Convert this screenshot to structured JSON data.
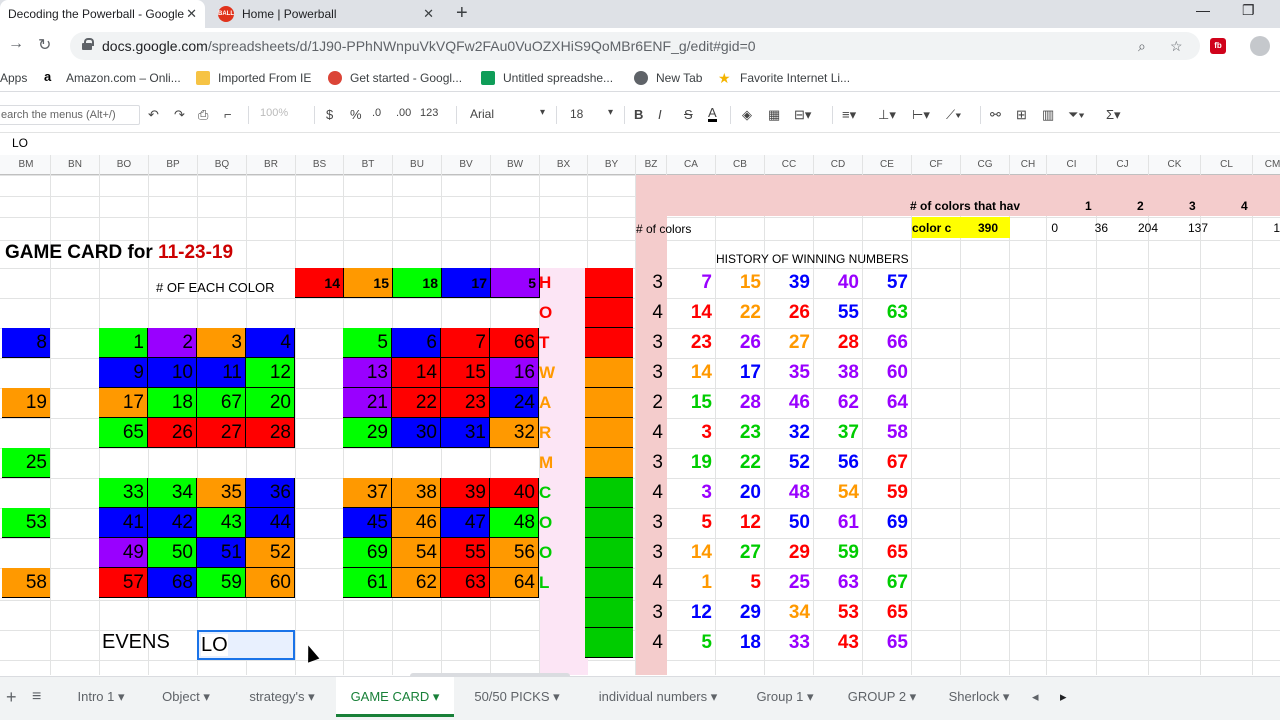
{
  "browser": {
    "tabs": [
      {
        "title": "Decoding the Powerball - Google",
        "active": true
      },
      {
        "title": "Home | Powerball",
        "active": false,
        "favicon_text": "BALL"
      }
    ],
    "new_tab_label": "+",
    "url_host": "docs.google.com",
    "url_path": "/spreadsheets/d/1J90-PPhNWnpuVkVQFw2FAu0VuOZXHiS9QoMBr6ENF_g/edit#gid=0",
    "bookmarks": [
      {
        "label": "Apps",
        "icon": "apps-grid-icon"
      },
      {
        "label": "Amazon.com – Onli...",
        "icon": "amazon-icon"
      },
      {
        "label": "Imported From IE",
        "icon": "folder-icon"
      },
      {
        "label": "Get started - Googl...",
        "icon": "chrome-icon"
      },
      {
        "label": "Untitled spreadshe...",
        "icon": "sheets-icon"
      },
      {
        "label": "New Tab",
        "icon": "globe-icon"
      },
      {
        "label": "Favorite Internet Li...",
        "icon": "star-icon"
      }
    ]
  },
  "toolbar": {
    "search_placeholder": "earch the menus (Alt+/)",
    "zoom": "100%",
    "currency": "$",
    "percent": "%",
    "dec_less": ".0",
    "dec_more": ".00",
    "format": "123",
    "font": "Arial",
    "font_size": "18",
    "bold": "B",
    "italic": "I",
    "strike": "S",
    "text_color": "A"
  },
  "formula_bar": {
    "value": "LO"
  },
  "columns": [
    "BM",
    "BN",
    "BO",
    "BP",
    "BQ",
    "BR",
    "BS",
    "BT",
    "BU",
    "BV",
    "BW",
    "BX",
    "BY",
    "BZ",
    "CA",
    "CB",
    "CC",
    "CD",
    "CE",
    "CF",
    "CG",
    "CH",
    "CI",
    "CJ",
    "CK",
    "CL",
    "CM"
  ],
  "sheet": {
    "title_prefix": "GAME CARD for ",
    "title_date": "11-23-19",
    "each_color_label": "# OF EACH COLOR",
    "color_counts": [
      {
        "value": "14",
        "color": "#ff0000"
      },
      {
        "value": "15",
        "color": "#ff9900"
      },
      {
        "value": "18",
        "color": "#00ff00"
      },
      {
        "value": "17",
        "color": "#0000ff"
      },
      {
        "value": "5",
        "color": "#9900ff"
      }
    ],
    "num_colors_label": "# of colors",
    "colors_that_have_label": "# of colors that hav",
    "colors_that_have_values": [
      "1",
      "2",
      "3",
      "4"
    ],
    "color_c_label": "color c",
    "color_c_value": "390",
    "color_c_row": [
      "0",
      "36",
      "204",
      "137",
      "1"
    ],
    "history_label": "HISTORY OF WINNING NUMBERS",
    "evens_label": "EVENS",
    "active_cell_value": "LO",
    "left_numbers": [
      {
        "value": "8",
        "color": "#0000ff"
      },
      {
        "value": "19",
        "color": "#ff9900"
      },
      {
        "value": "25",
        "color": "#00ff00"
      },
      {
        "value": "53",
        "color": "#00ff00"
      },
      {
        "value": "58",
        "color": "#ff9900"
      }
    ],
    "card_left": [
      [
        {
          "v": "1",
          "c": "#00ff00"
        },
        {
          "v": "2",
          "c": "#9900ff"
        },
        {
          "v": "3",
          "c": "#ff9900"
        },
        {
          "v": "4",
          "c": "#0000ff"
        }
      ],
      [
        {
          "v": "9",
          "c": "#0000ff"
        },
        {
          "v": "10",
          "c": "#0000ff"
        },
        {
          "v": "11",
          "c": "#0000ff"
        },
        {
          "v": "12",
          "c": "#00ff00"
        }
      ],
      [
        {
          "v": "17",
          "c": "#ff9900"
        },
        {
          "v": "18",
          "c": "#00ff00"
        },
        {
          "v": "67",
          "c": "#00ff00"
        },
        {
          "v": "20",
          "c": "#00ff00"
        }
      ],
      [
        {
          "v": "65",
          "c": "#00ff00"
        },
        {
          "v": "26",
          "c": "#ff0000"
        },
        {
          "v": "27",
          "c": "#ff0000"
        },
        {
          "v": "28",
          "c": "#ff0000"
        }
      ],
      [],
      [
        {
          "v": "33",
          "c": "#00ff00"
        },
        {
          "v": "34",
          "c": "#00ff00"
        },
        {
          "v": "35",
          "c": "#ff9900"
        },
        {
          "v": "36",
          "c": "#0000ff"
        }
      ],
      [
        {
          "v": "41",
          "c": "#0000ff"
        },
        {
          "v": "42",
          "c": "#0000ff"
        },
        {
          "v": "43",
          "c": "#00ff00"
        },
        {
          "v": "44",
          "c": "#0000ff"
        }
      ],
      [
        {
          "v": "49",
          "c": "#9900ff"
        },
        {
          "v": "50",
          "c": "#00ff00"
        },
        {
          "v": "51",
          "c": "#0000ff"
        },
        {
          "v": "52",
          "c": "#ff9900"
        }
      ],
      [
        {
          "v": "57",
          "c": "#ff0000"
        },
        {
          "v": "68",
          "c": "#0000ff"
        },
        {
          "v": "59",
          "c": "#00ff00"
        },
        {
          "v": "60",
          "c": "#ff9900"
        }
      ]
    ],
    "card_right": [
      [
        {
          "v": "5",
          "c": "#00ff00"
        },
        {
          "v": "6",
          "c": "#0000ff"
        },
        {
          "v": "7",
          "c": "#ff0000"
        },
        {
          "v": "66",
          "c": "#ff0000"
        }
      ],
      [
        {
          "v": "13",
          "c": "#9900ff"
        },
        {
          "v": "14",
          "c": "#ff0000"
        },
        {
          "v": "15",
          "c": "#ff0000"
        },
        {
          "v": "16",
          "c": "#9900ff"
        }
      ],
      [
        {
          "v": "21",
          "c": "#9900ff"
        },
        {
          "v": "22",
          "c": "#ff0000"
        },
        {
          "v": "23",
          "c": "#ff0000"
        },
        {
          "v": "24",
          "c": "#0000ff"
        }
      ],
      [
        {
          "v": "29",
          "c": "#00ff00"
        },
        {
          "v": "30",
          "c": "#0000ff"
        },
        {
          "v": "31",
          "c": "#0000ff"
        },
        {
          "v": "32",
          "c": "#ff9900"
        }
      ],
      [],
      [
        {
          "v": "37",
          "c": "#ff9900"
        },
        {
          "v": "38",
          "c": "#ff9900"
        },
        {
          "v": "39",
          "c": "#ff0000"
        },
        {
          "v": "40",
          "c": "#ff0000"
        }
      ],
      [
        {
          "v": "45",
          "c": "#0000ff"
        },
        {
          "v": "46",
          "c": "#ff9900"
        },
        {
          "v": "47",
          "c": "#0000ff"
        },
        {
          "v": "48",
          "c": "#00ff00"
        }
      ],
      [
        {
          "v": "69",
          "c": "#00ff00"
        },
        {
          "v": "54",
          "c": "#ff9900"
        },
        {
          "v": "55",
          "c": "#ff0000"
        },
        {
          "v": "56",
          "c": "#ff9900"
        }
      ],
      [
        {
          "v": "61",
          "c": "#00ff00"
        },
        {
          "v": "62",
          "c": "#ff9900"
        },
        {
          "v": "63",
          "c": "#ff0000"
        },
        {
          "v": "64",
          "c": "#ff9900"
        }
      ]
    ],
    "hot_cold_letters": [
      {
        "l": "H",
        "c": "#ff0000"
      },
      {
        "l": "O",
        "c": "#ff0000"
      },
      {
        "l": "T",
        "c": "#ff0000"
      },
      {
        "l": "W",
        "c": "#ff9900"
      },
      {
        "l": "A",
        "c": "#ff9900"
      },
      {
        "l": "R",
        "c": "#ff9900"
      },
      {
        "l": "M",
        "c": "#ff9900"
      },
      {
        "l": "C",
        "c": "#00cc00"
      },
      {
        "l": "O",
        "c": "#00cc00"
      },
      {
        "l": "O",
        "c": "#00cc00"
      },
      {
        "l": "L",
        "c": "#00cc00"
      }
    ],
    "side_colors": [
      "#ff0000",
      "#ff0000",
      "#ff0000",
      "#ff9900",
      "#ff9900",
      "#ff9900",
      "#ff9900",
      "#00cc00",
      "#00cc00",
      "#00cc00",
      "#00cc00",
      "#00cc00",
      "#00cc00"
    ],
    "history": [
      {
        "count": "3",
        "nums": [
          {
            "v": "7",
            "c": "#9900ff"
          },
          {
            "v": "15",
            "c": "#ff9900"
          },
          {
            "v": "39",
            "c": "#0000ff"
          },
          {
            "v": "40",
            "c": "#9900ff"
          },
          {
            "v": "57",
            "c": "#0000ff"
          }
        ]
      },
      {
        "count": "4",
        "nums": [
          {
            "v": "14",
            "c": "#ff0000"
          },
          {
            "v": "22",
            "c": "#ff9900"
          },
          {
            "v": "26",
            "c": "#ff0000"
          },
          {
            "v": "55",
            "c": "#0000ff"
          },
          {
            "v": "63",
            "c": "#00cc00"
          }
        ]
      },
      {
        "count": "3",
        "nums": [
          {
            "v": "23",
            "c": "#ff0000"
          },
          {
            "v": "26",
            "c": "#9900ff"
          },
          {
            "v": "27",
            "c": "#ff9900"
          },
          {
            "v": "28",
            "c": "#ff0000"
          },
          {
            "v": "66",
            "c": "#9900ff"
          }
        ]
      },
      {
        "count": "3",
        "nums": [
          {
            "v": "14",
            "c": "#ff9900"
          },
          {
            "v": "17",
            "c": "#0000ff"
          },
          {
            "v": "35",
            "c": "#9900ff"
          },
          {
            "v": "38",
            "c": "#9900ff"
          },
          {
            "v": "60",
            "c": "#9900ff"
          }
        ]
      },
      {
        "count": "2",
        "nums": [
          {
            "v": "15",
            "c": "#00cc00"
          },
          {
            "v": "28",
            "c": "#9900ff"
          },
          {
            "v": "46",
            "c": "#9900ff"
          },
          {
            "v": "62",
            "c": "#9900ff"
          },
          {
            "v": "64",
            "c": "#9900ff"
          }
        ]
      },
      {
        "count": "4",
        "nums": [
          {
            "v": "3",
            "c": "#ff0000"
          },
          {
            "v": "23",
            "c": "#00cc00"
          },
          {
            "v": "32",
            "c": "#0000ff"
          },
          {
            "v": "37",
            "c": "#00cc00"
          },
          {
            "v": "58",
            "c": "#9900ff"
          }
        ]
      },
      {
        "count": "3",
        "nums": [
          {
            "v": "19",
            "c": "#00cc00"
          },
          {
            "v": "22",
            "c": "#00cc00"
          },
          {
            "v": "52",
            "c": "#0000ff"
          },
          {
            "v": "56",
            "c": "#0000ff"
          },
          {
            "v": "67",
            "c": "#ff0000"
          }
        ]
      },
      {
        "count": "4",
        "nums": [
          {
            "v": "3",
            "c": "#9900ff"
          },
          {
            "v": "20",
            "c": "#0000ff"
          },
          {
            "v": "48",
            "c": "#9900ff"
          },
          {
            "v": "54",
            "c": "#ff9900"
          },
          {
            "v": "59",
            "c": "#ff0000"
          }
        ]
      },
      {
        "count": "3",
        "nums": [
          {
            "v": "5",
            "c": "#ff0000"
          },
          {
            "v": "12",
            "c": "#ff0000"
          },
          {
            "v": "50",
            "c": "#0000ff"
          },
          {
            "v": "61",
            "c": "#9900ff"
          },
          {
            "v": "69",
            "c": "#0000ff"
          }
        ]
      },
      {
        "count": "3",
        "nums": [
          {
            "v": "14",
            "c": "#ff9900"
          },
          {
            "v": "27",
            "c": "#00cc00"
          },
          {
            "v": "29",
            "c": "#ff0000"
          },
          {
            "v": "59",
            "c": "#00cc00"
          },
          {
            "v": "65",
            "c": "#ff0000"
          }
        ]
      },
      {
        "count": "4",
        "nums": [
          {
            "v": "1",
            "c": "#ff9900"
          },
          {
            "v": "5",
            "c": "#ff0000"
          },
          {
            "v": "25",
            "c": "#9900ff"
          },
          {
            "v": "63",
            "c": "#9900ff"
          },
          {
            "v": "67",
            "c": "#00cc00"
          }
        ]
      },
      {
        "count": "3",
        "nums": [
          {
            "v": "12",
            "c": "#0000ff"
          },
          {
            "v": "29",
            "c": "#0000ff"
          },
          {
            "v": "34",
            "c": "#ff9900"
          },
          {
            "v": "53",
            "c": "#ff0000"
          },
          {
            "v": "65",
            "c": "#ff0000"
          }
        ]
      },
      {
        "count": "4",
        "nums": [
          {
            "v": "5",
            "c": "#00cc00"
          },
          {
            "v": "18",
            "c": "#0000ff"
          },
          {
            "v": "33",
            "c": "#9900ff"
          },
          {
            "v": "43",
            "c": "#ff0000"
          },
          {
            "v": "65",
            "c": "#9900ff"
          }
        ]
      }
    ]
  },
  "sheet_tabs": [
    {
      "label": "Intro 1"
    },
    {
      "label": "Object"
    },
    {
      "label": "strategy's"
    },
    {
      "label": "GAME CARD",
      "active": true
    },
    {
      "label": "50/50 PICKS"
    },
    {
      "label": "individual numbers"
    },
    {
      "label": "Group 1"
    },
    {
      "label": "GROUP 2"
    },
    {
      "label": "Sherlock"
    }
  ],
  "colors": {
    "pink_band": "#f4cccc",
    "light_pink": "#fce5f5",
    "active_cell_border": "#1a73e8",
    "yellow": "#ffff00"
  }
}
